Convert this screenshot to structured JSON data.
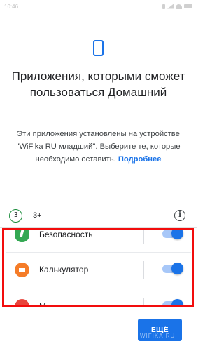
{
  "status_bar": {
    "time": "10:46"
  },
  "header": {
    "icon": "smartphone-icon",
    "title": "Приложения, которыми сможет пользоваться Домашний"
  },
  "description": {
    "text": "Эти приложения установлены на устройстве \"WiFika RU младший\". Выберите те, которые необходимо оставить.",
    "link": "Подробнее"
  },
  "section": {
    "count": "3",
    "age_rating": "3+",
    "info_icon": "i"
  },
  "apps": [
    {
      "label": "Безопасность",
      "icon": "shield-icon",
      "enabled": true
    },
    {
      "label": "Калькулятор",
      "icon": "calculator-icon",
      "enabled": true
    },
    {
      "label": "М",
      "icon": "app-icon",
      "enabled": true
    }
  ],
  "actions": {
    "more_label": "ЕЩЁ"
  },
  "watermark": "WIFIKA.RU",
  "colors": {
    "accent": "#1a73e8",
    "highlight": "#f20d0d",
    "badge_ring": "#1e8e3e"
  }
}
